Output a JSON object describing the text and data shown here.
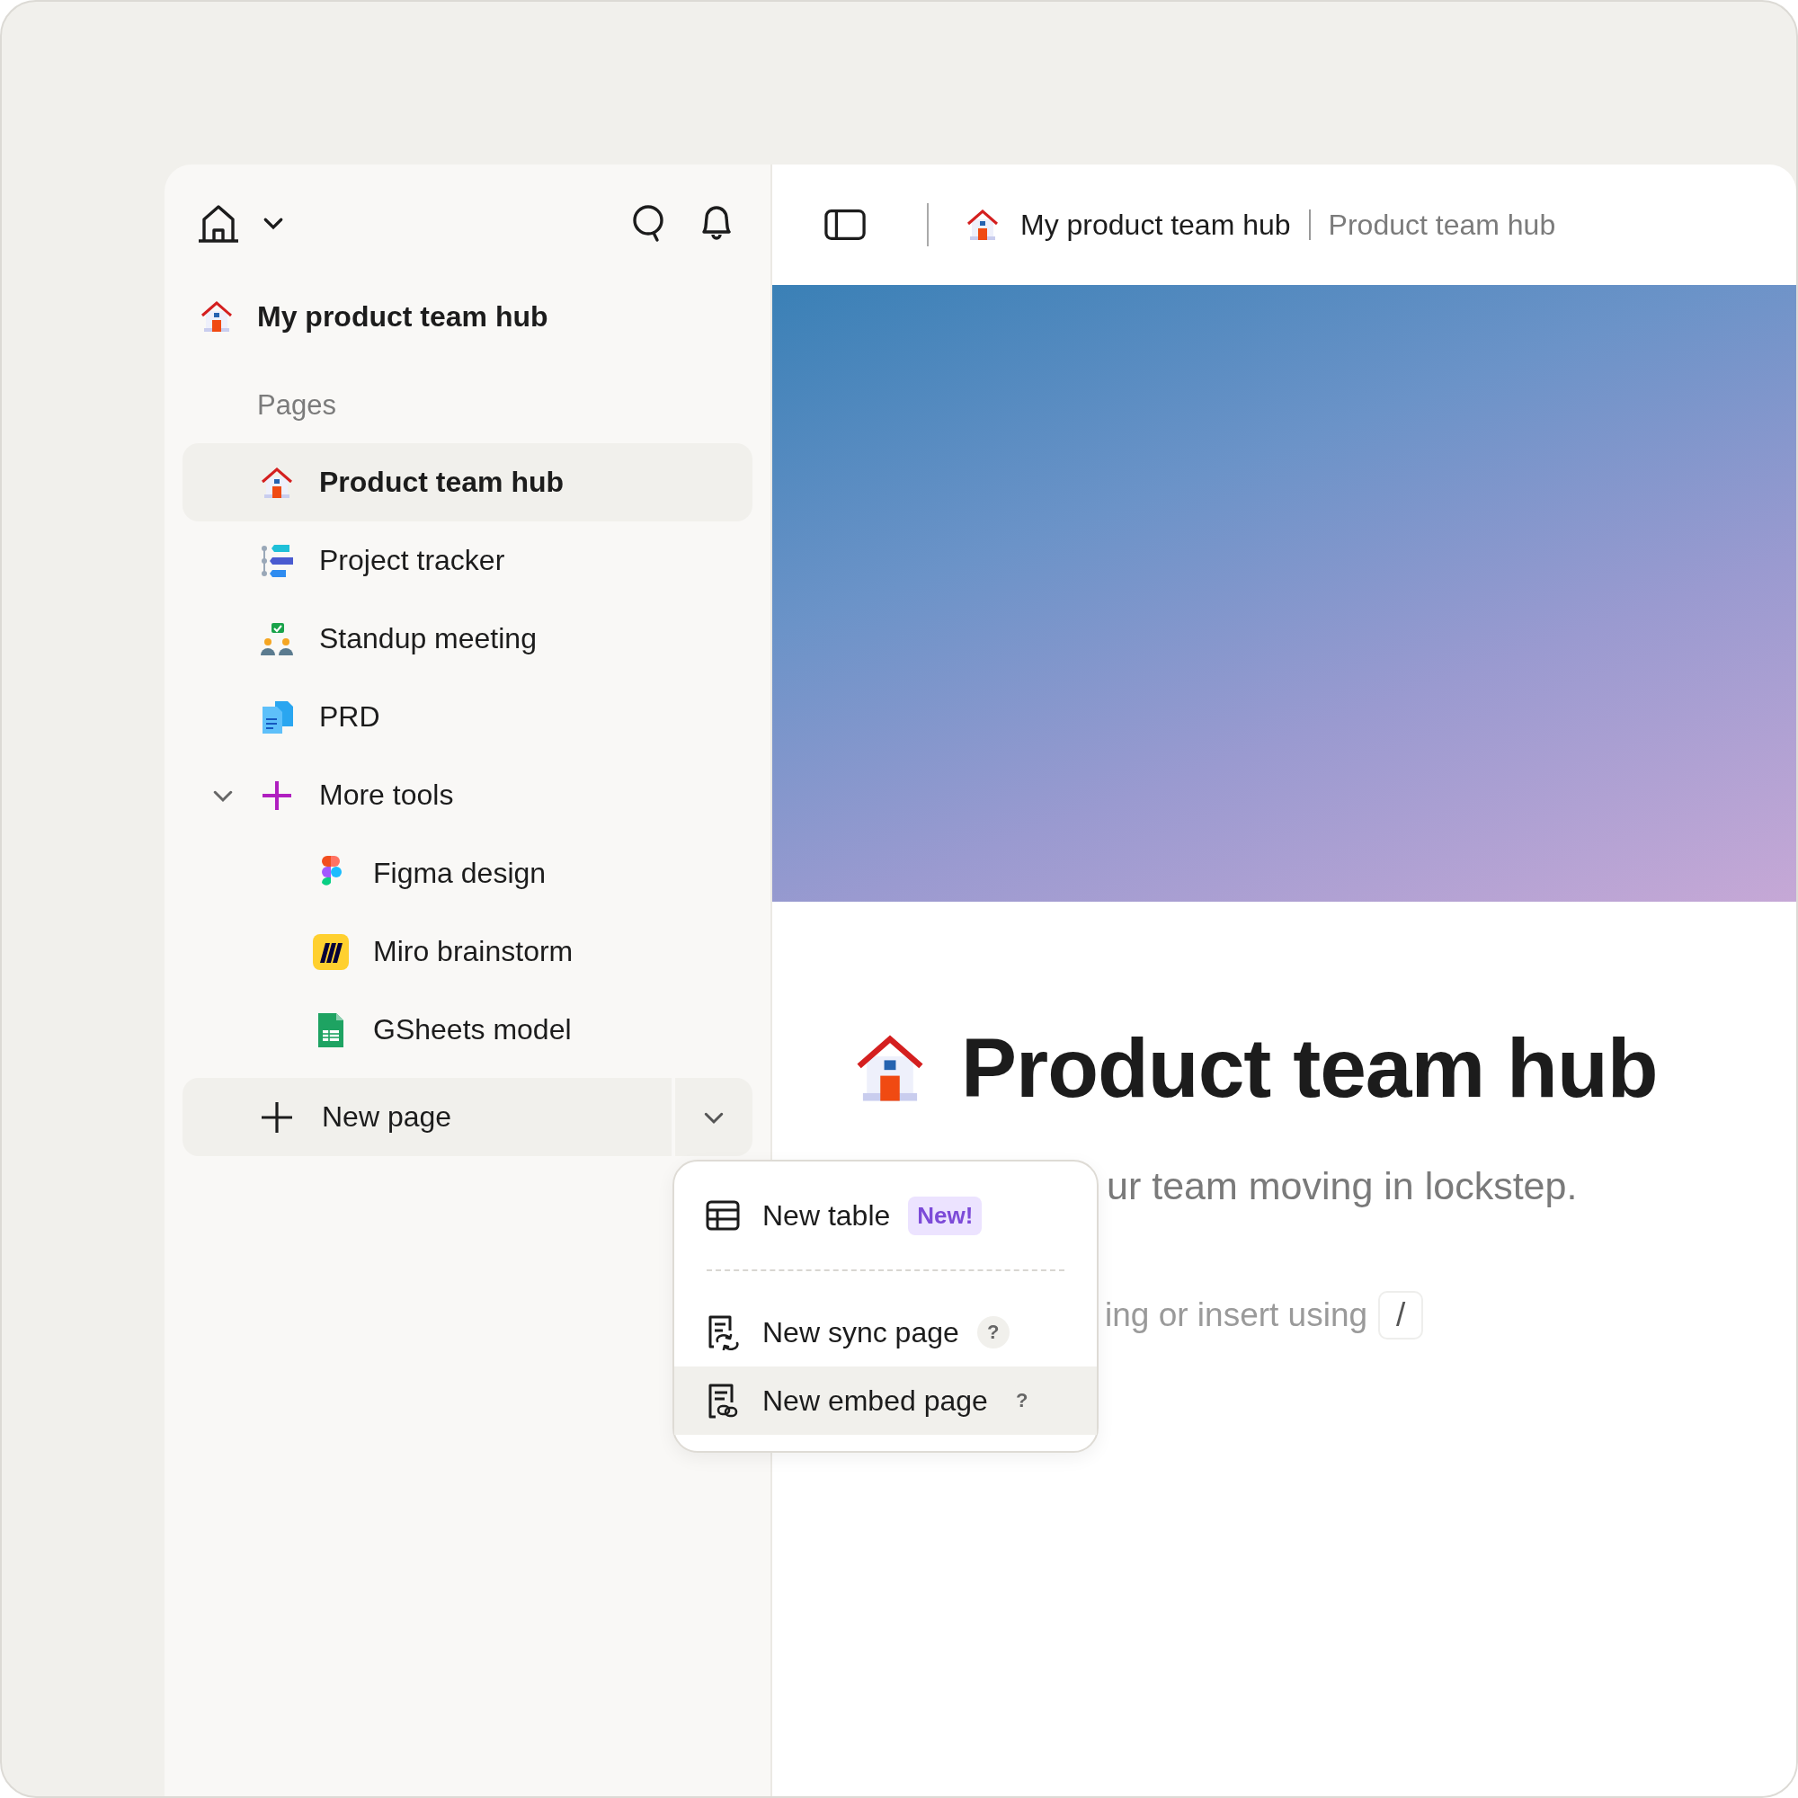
{
  "sidebar": {
    "workspace": "My product team hub",
    "section_label": "Pages",
    "pages": [
      {
        "label": "Product team hub",
        "selected": true
      },
      {
        "label": "Project tracker",
        "selected": false
      },
      {
        "label": "Standup meeting",
        "selected": false
      },
      {
        "label": "PRD",
        "selected": false
      },
      {
        "label": "More tools",
        "selected": false,
        "expanded": true,
        "children": [
          {
            "label": "Figma design",
            "selected": false
          },
          {
            "label": "Miro brainstorm",
            "selected": false
          },
          {
            "label": "GSheets model",
            "selected": false
          }
        ]
      }
    ],
    "new_page_button": "New page"
  },
  "header": {
    "breadcrumb": [
      "My product team hub",
      "Product team hub"
    ]
  },
  "page": {
    "title": "Product team hub",
    "subtitle": "ur team moving in lockstep.",
    "placeholder": "ing or insert using",
    "shortcut_key": "/"
  },
  "menu": {
    "items": [
      {
        "kind": "table",
        "label": "New table",
        "badge": "New!",
        "selected": false
      },
      {
        "kind": "sync",
        "label": "New sync page",
        "help": "?",
        "selected": false
      },
      {
        "kind": "embed",
        "label": "New embed page",
        "help": "?",
        "selected": true
      }
    ]
  }
}
